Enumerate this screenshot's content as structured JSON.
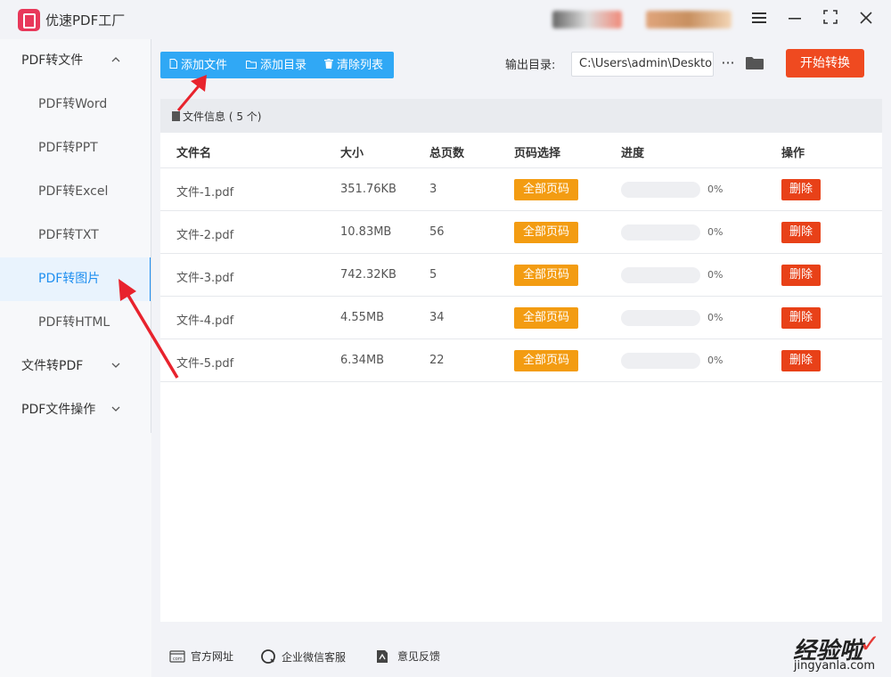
{
  "app": {
    "title": "优速PDF工厂"
  },
  "window_controls": [
    "menu-icon",
    "minimize-icon",
    "maximize-icon",
    "close-icon"
  ],
  "sidebar": {
    "groups": [
      {
        "label": "PDF转文件",
        "expanded": true,
        "items": [
          "PDF转Word",
          "PDF转PPT",
          "PDF转Excel",
          "PDF转TXT",
          "PDF转图片",
          "PDF转HTML"
        ]
      },
      {
        "label": "文件转PDF",
        "expanded": false
      },
      {
        "label": "PDF文件操作",
        "expanded": false
      }
    ],
    "active_item": "PDF转图片"
  },
  "toolbar": {
    "add_file": "添加文件",
    "add_dir": "添加目录",
    "clear_list": "清除列表",
    "output_label": "输出目录:",
    "output_path": "C:\\Users\\admin\\Deskto",
    "more": "···",
    "start": "开始转换"
  },
  "file_info": {
    "label": "文件信息",
    "count_text": "( 5 个)"
  },
  "table": {
    "headers": {
      "name": "文件名",
      "size": "大小",
      "pages": "总页数",
      "page_select": "页码选择",
      "progress": "进度",
      "action": "操作"
    },
    "rows": [
      {
        "name": "文件-1.pdf",
        "size": "351.76KB",
        "pages": "3",
        "page_select": "全部页码",
        "progress": "0%",
        "progress_value": 0,
        "action": "删除"
      },
      {
        "name": "文件-2.pdf",
        "size": "10.83MB",
        "pages": "56",
        "page_select": "全部页码",
        "progress": "0%",
        "progress_value": 0,
        "action": "删除"
      },
      {
        "name": "文件-3.pdf",
        "size": "742.32KB",
        "pages": "5",
        "page_select": "全部页码",
        "progress": "0%",
        "progress_value": 0,
        "action": "删除"
      },
      {
        "name": "文件-4.pdf",
        "size": "4.55MB",
        "pages": "34",
        "page_select": "全部页码",
        "progress": "0%",
        "progress_value": 0,
        "action": "删除"
      },
      {
        "name": "文件-5.pdf",
        "size": "6.34MB",
        "pages": "22",
        "page_select": "全部页码",
        "progress": "0%",
        "progress_value": 0,
        "action": "删除"
      }
    ]
  },
  "footer": {
    "website": "官方网址",
    "wechat": "企业微信客服",
    "feedback": "意见反馈"
  },
  "watermark": {
    "text": "经验啦",
    "url": "jingyanla.com"
  },
  "colors": {
    "accent": "#30a8f5",
    "start": "#ef4a20",
    "page_btn": "#f39c12",
    "delete": "#e84118",
    "active_nav": "#1f8ff0",
    "annotation": "#e8232d"
  }
}
